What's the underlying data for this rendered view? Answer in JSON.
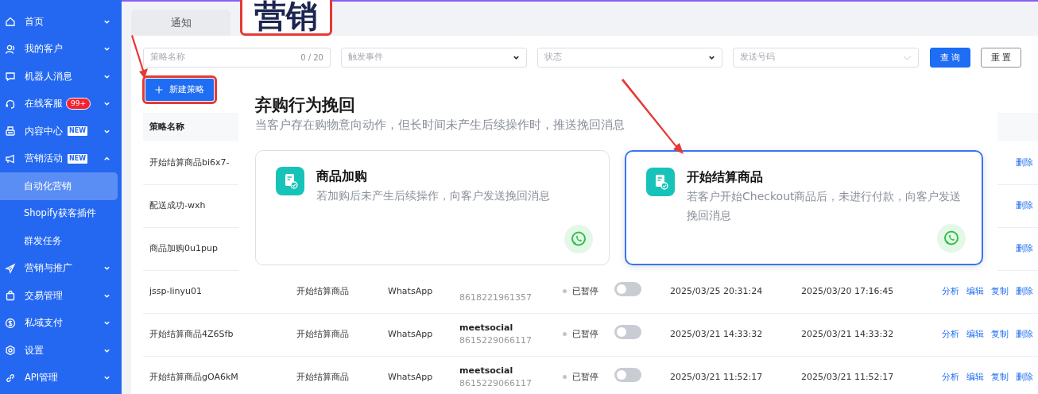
{
  "sidebar": {
    "items": [
      {
        "label": "首页",
        "expanded": false
      },
      {
        "label": "我的客户",
        "expanded": false
      },
      {
        "label": "机器人消息",
        "expanded": false
      },
      {
        "label": "在线客服",
        "expanded": false,
        "badge": "99+"
      },
      {
        "label": "内容中心",
        "expanded": false,
        "tag": "NEW"
      },
      {
        "label": "营销活动",
        "expanded": true,
        "tag": "NEW",
        "children": [
          {
            "label": "自动化营销",
            "selected": true
          },
          {
            "label": "Shopify获客插件",
            "selected": false
          },
          {
            "label": "群发任务",
            "selected": false
          }
        ]
      },
      {
        "label": "营销与推广",
        "expanded": false
      },
      {
        "label": "交易管理",
        "expanded": false
      },
      {
        "label": "私域支付",
        "expanded": false
      },
      {
        "label": "设置",
        "expanded": false
      },
      {
        "label": "API管理",
        "expanded": false
      }
    ]
  },
  "tabs": [
    {
      "label": "通知",
      "selected": false
    },
    {
      "label": "营销",
      "selected": true,
      "highlighted": true
    }
  ],
  "filters": [
    {
      "kind": "text",
      "placeholder": "策略名称",
      "counter": "0 / 20"
    },
    {
      "kind": "select",
      "placeholder": "触发事件"
    },
    {
      "kind": "select",
      "placeholder": "状态"
    },
    {
      "kind": "picker",
      "placeholder": "发送号码"
    }
  ],
  "buttons": [
    {
      "label": "查 询",
      "kind": "primary"
    },
    {
      "label": "重 置",
      "kind": "outline"
    }
  ],
  "new_button": {
    "label": "新建策略",
    "highlighted": true
  },
  "table": {
    "columns": [
      {
        "label": "策略名称"
      }
    ],
    "rows": [
      {
        "name": "开始结算商品bi6x7-",
        "actions": [
          "删除"
        ]
      },
      {
        "name": "配送成功-wxh",
        "actions": [
          "删除"
        ]
      },
      {
        "name": "商品加购0u1pup",
        "actions": [
          "删除"
        ]
      },
      {
        "name": "jssp-linyu01",
        "trigger": "开始结算商品",
        "channel": "WhatsApp",
        "sender_number": "8618221961357",
        "status": "已暂停",
        "on": false,
        "created": "2025/03/25 20:31:24",
        "updated": "2025/03/20 17:16:45",
        "actions": [
          "分析",
          "编辑",
          "复制",
          "删除"
        ]
      },
      {
        "name": "开始结算商品4Z6Sfb",
        "trigger": "开始结算商品",
        "channel": "WhatsApp",
        "sender_name": "meetsocial",
        "sender_number": "8615229066117",
        "status": "已暂停",
        "on": false,
        "created": "2025/03/21 14:33:32",
        "updated": "2025/03/21 14:33:32",
        "actions": [
          "分析",
          "编辑",
          "复制",
          "删除"
        ]
      },
      {
        "name": "开始结算商品gOA6kM",
        "trigger": "开始结算商品",
        "channel": "WhatsApp",
        "sender_name": "meetsocial",
        "sender_number": "8615229066117",
        "status": "已暂停",
        "on": false,
        "created": "2025/03/21 11:52:17",
        "updated": "2025/03/21 11:52:17",
        "actions": [
          "分析",
          "编辑",
          "复制",
          "删除"
        ]
      }
    ]
  },
  "panel": {
    "title": "弃购行为挽回",
    "subtitle": "当客户存在购物意向动作，但长时间未产生后续操作时，推送挽回消息",
    "cards": [
      {
        "title": "商品加购",
        "description": "若加购后未产生后续操作，向客户发送挽回消息",
        "selected": false
      },
      {
        "title": "开始结算商品",
        "description": "若客户开始Checkout商品后，未进行付款，向客户发送挽回消息",
        "selected": true
      }
    ]
  }
}
